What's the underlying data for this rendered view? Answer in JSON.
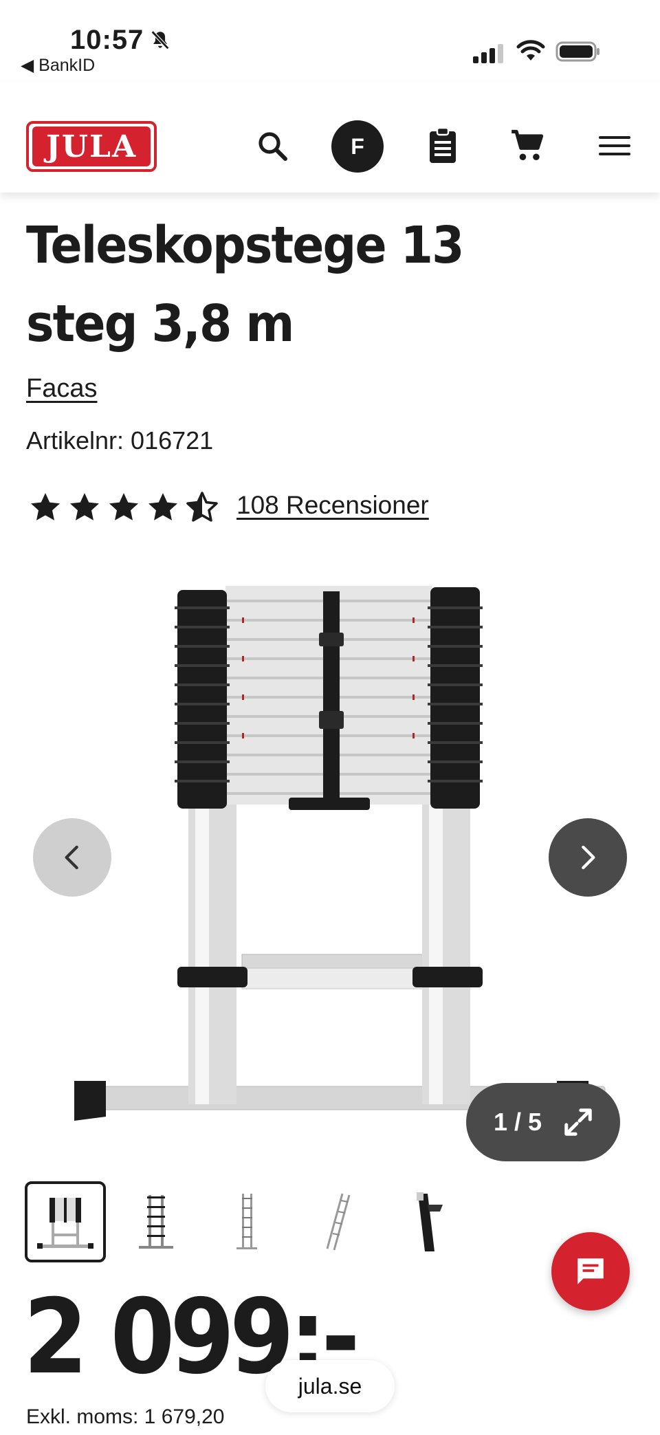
{
  "status_bar": {
    "time": "10:57",
    "back_app": "◀ BankID"
  },
  "header": {
    "logo_text": "JULA",
    "avatar_initial": "F",
    "icons": [
      "search-icon",
      "avatar",
      "clipboard-list-icon",
      "cart-icon",
      "hamburger-menu-icon"
    ]
  },
  "product": {
    "title": "Teleskopstege 13 steg 3,8 m",
    "brand": "Facas",
    "article_label": "Artikelnr:",
    "article_number": "016721",
    "rating": 4.5,
    "rating_max": 5,
    "reviews_text": "108 Recensioner"
  },
  "gallery": {
    "counter": "1 / 5",
    "current_index": 1,
    "total": 5,
    "thumbnail_count": 5,
    "active_thumbnail": 1
  },
  "price": {
    "amount": "2 099:-",
    "excl_vat": "Exkl. moms: 1 679,20"
  },
  "browser": {
    "url": "jula.se"
  },
  "colors": {
    "brand_red": "#d4232f",
    "text": "#1c1c1c",
    "nav_dark": "#4a4a4a",
    "nav_light": "#cfcfcf"
  }
}
